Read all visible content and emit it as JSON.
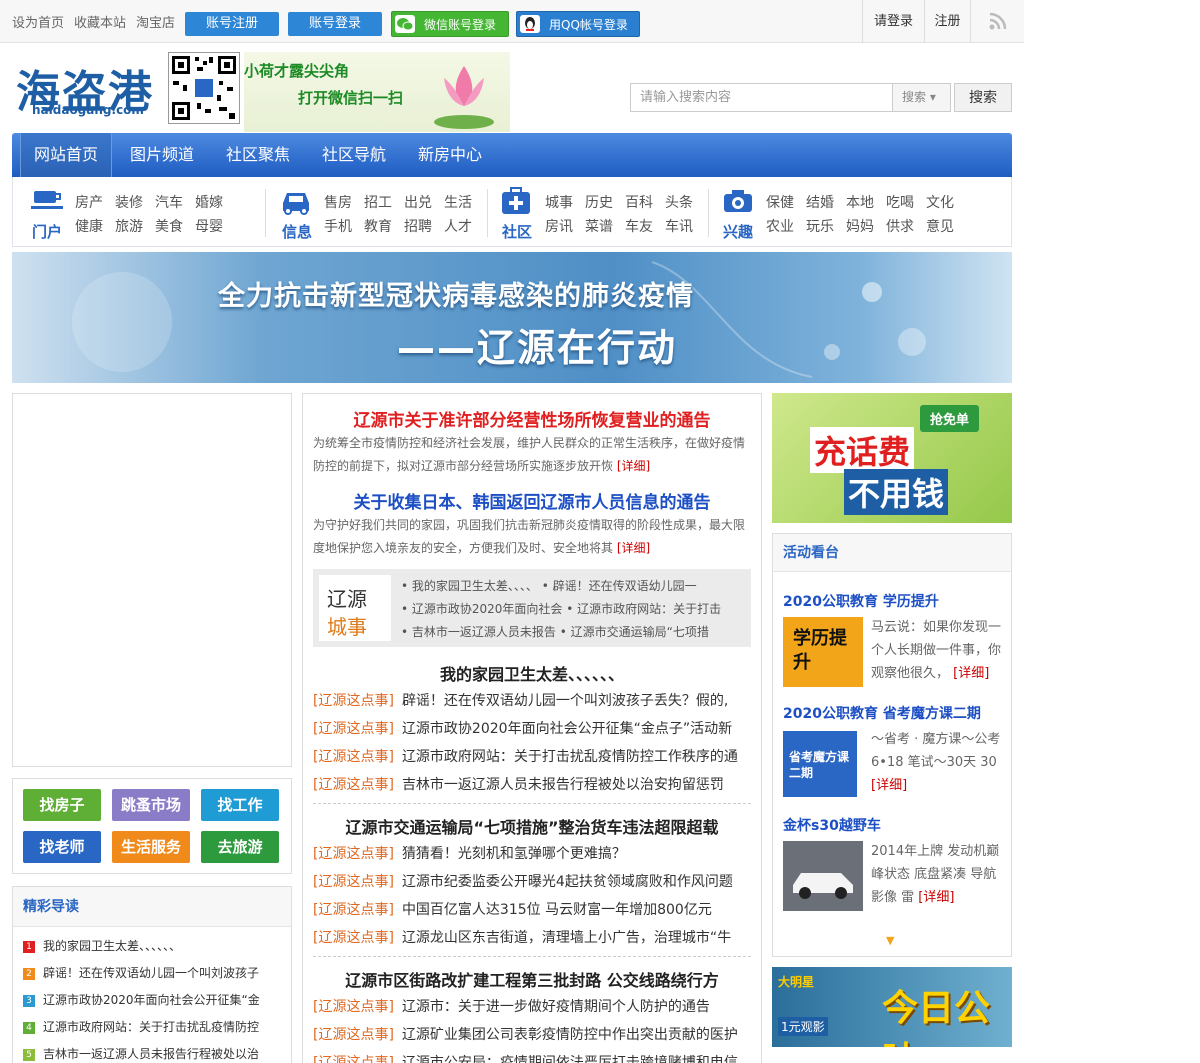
{
  "topbar": {
    "set_home": "设为首页",
    "bookmark": "收藏本站",
    "taobao": "淘宝店",
    "register": "账号注册",
    "login": "账号登录",
    "wechat_login": "微信账号登录",
    "qq_login": "用QQ帐号登录",
    "please_login": "请登录",
    "signup": "注册"
  },
  "header": {
    "logo_text": "海盗港",
    "logo_domain": "haidaogang.com",
    "wx_banner_line1": "小荷才露尖尖角",
    "wx_banner_line2": "打开微信扫一扫",
    "search_placeholder": "请输入搜索内容",
    "search_type": "搜索",
    "search_button": "搜索"
  },
  "nav": {
    "items": [
      "网站首页",
      "图片频道",
      "社区聚焦",
      "社区导航",
      "新房中心"
    ]
  },
  "categories": [
    {
      "title": "门户",
      "links": [
        "房产",
        "装修",
        "汽车",
        "婚嫁",
        "健康",
        "旅游",
        "美食",
        "母婴"
      ]
    },
    {
      "title": "信息",
      "links": [
        "售房",
        "招工",
        "出兑",
        "生活",
        "手机",
        "教育",
        "招聘",
        "人才"
      ]
    },
    {
      "title": "社区",
      "links": [
        "城事",
        "历史",
        "百科",
        "头条",
        "房讯",
        "菜谱",
        "车友",
        "车讯"
      ]
    },
    {
      "title": "兴趣",
      "links": [
        "保健",
        "结婚",
        "本地",
        "吃喝",
        "文化",
        "农业",
        "玩乐",
        "妈妈",
        "供求",
        "意见"
      ]
    }
  ],
  "banner": {
    "line1": "全力抗击新型冠状病毒感染的肺炎疫情",
    "line2": "——辽源在行动"
  },
  "quick_buttons": [
    {
      "label": "找房子",
      "color": "#5fae35"
    },
    {
      "label": "跳蚤市场",
      "color": "#8b7cc8"
    },
    {
      "label": "找工作",
      "color": "#1e9cd3"
    },
    {
      "label": "找老师",
      "color": "#2a66c4"
    },
    {
      "label": "生活服务",
      "color": "#f08a1a"
    },
    {
      "label": "去旅游",
      "color": "#2d9a3e"
    }
  ],
  "featured": {
    "title": "精彩导读",
    "items": [
      {
        "num": "1",
        "color": "#e02020",
        "text": "我的家园卫生太差、、、、、、"
      },
      {
        "num": "2",
        "color": "#f08a1a",
        "text": "辟谣！还在传双语幼儿园一个叫刘波孩子"
      },
      {
        "num": "3",
        "color": "#2a9ad0",
        "text": "辽源市政协2020年面向社会公开征集“金"
      },
      {
        "num": "4",
        "color": "#5fae35",
        "text": "辽源市政府网站：关于打击扰乱疫情防控"
      },
      {
        "num": "5",
        "color": "#8bbd3a",
        "text": "吉林市一返辽源人员未报告行程被处以治"
      }
    ]
  },
  "center": {
    "headline1": "辽源市关于准许部分经营性场所恢复营业的通告",
    "summary1": "为统筹全市疫情防控和经济社会发展，维护人民群众的正常生活秩序，在做好疫情防控的前提下，拟对辽源市部分经营场所实施逐步放开恢",
    "headline2": "关于收集日本、韩国返回辽源市人员信息的通告",
    "summary2": "为守护好我们共同的家园，巩固我们抗击新冠肺炎疫情取得的阶段性成果，最大限度地保护您入境亲友的安全，方便我们及时、安全地将其",
    "more": "[详细]",
    "lycs_logo_1": "辽源",
    "lycs_logo_2": "城事",
    "lycs_lines": [
      "• 我的家园卫生太差、、、、 • 辟谣！还在传双语幼儿园一",
      "• 辽源市政协2020年面向社会 • 辽源市政府网站：关于打击",
      "• 吉林市一返辽源人员未报告 • 辽源市交通运输局“七项措"
    ],
    "tag": "[辽源这点事]",
    "sections": [
      {
        "title": "我的家园卫生太差、、、、、、",
        "items": [
          "辟谣！还在传双语幼儿园一个叫刘波孩子丢失？假的,",
          "辽源市政协2020年面向社会公开征集“金点子”活动新",
          "辽源市政府网站：关于打击扰乱疫情防控工作秩序的通",
          "吉林市一返辽源人员未报告行程被处以治安拘留惩罚"
        ]
      },
      {
        "title": "辽源市交通运输局“七项措施”整治货车违法超限超载",
        "items": [
          "猜猜看！光刻机和氢弹哪个更难搞？",
          "辽源市纪委监委公开曝光4起扶贫领域腐败和作风问题",
          "中国百亿富人达315位 马云财富一年增加800亿元",
          "辽源龙山区东吉街道，清理墙上小广告，治理城市“牛"
        ]
      },
      {
        "title": "辽源市区街路改扩建工程第三批封路 公交线路绕行方",
        "items": [
          "辽源市：关于进一步做好疫情期间个人防护的通告",
          "辽源矿业集团公司表彰疫情防控中作出突出贡献的医护",
          "辽源市公安局：疫情期间依法严厉打击跨境赌博和电信"
        ]
      }
    ]
  },
  "right": {
    "ad_phone_line1": "充话费",
    "ad_phone_line2": "不用钱",
    "ad_phone_badge": "抢免单",
    "activity_title": "活动看台",
    "activities": [
      {
        "title": "2020公职教育 学历提升",
        "img_text": "学历提升",
        "text": "马云说：如果你发现一个人长期做一件事，你观察他很久，",
        "more": "[详细]"
      },
      {
        "title": "2020公职教育 省考魔方课二期",
        "img_text": "省考魔方课二期",
        "text": "～省考 · 魔方课～公考 6•18 笔试～30天 30",
        "more": "[详细]"
      },
      {
        "title": "金杯s30越野车",
        "img_text": "",
        "text": "2014年上牌 发动机巅峰状态 底盘紧凑 导航 影像 雷",
        "more": "[详细]"
      }
    ],
    "ad_movie_text": "今日公映",
    "ad_movie_brand": "大明星",
    "ad_movie_price": "1元观影"
  },
  "colors": {
    "brand_blue": "#1d5ea5",
    "nav_blue": "#2a66c4",
    "headline_red": "#e02020",
    "tag_orange": "#e06820"
  }
}
